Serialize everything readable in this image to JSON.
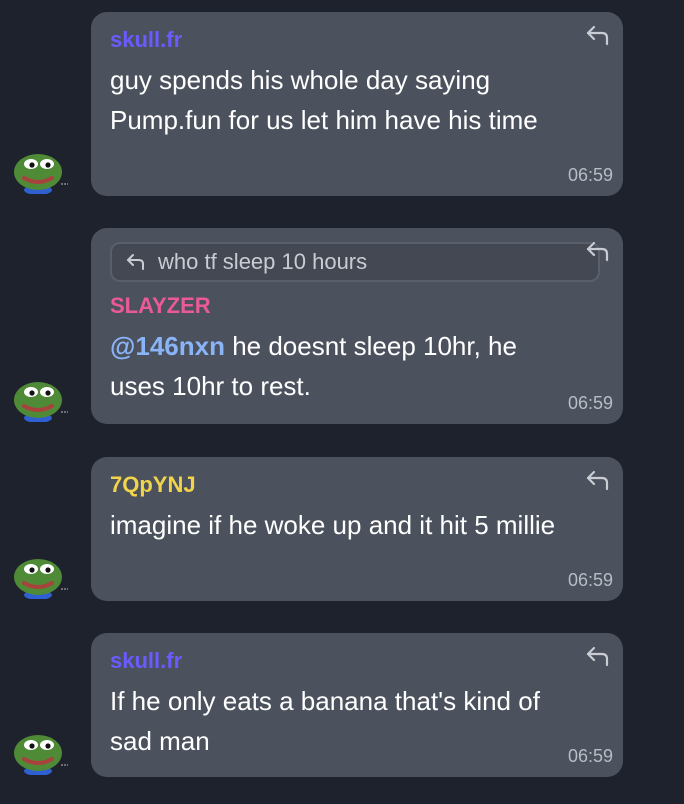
{
  "messages": [
    {
      "sender": "skull.fr",
      "sender_color": "#6a5bff",
      "text": "guy spends his whole day saying Pump.fun for us let him have his time",
      "time": "06:59"
    },
    {
      "quote": "who tf sleep 10 hours",
      "sender": "SLAYZER",
      "sender_color": "#ea5a96",
      "mention": "@146nxn",
      "text": " he doesnt sleep 10hr, he uses 10hr to rest.",
      "time": "06:59"
    },
    {
      "sender": "7QpYNJ",
      "sender_color": "#f0d44a",
      "text": "imagine if he woke up and it hit 5 millie",
      "time": "06:59"
    },
    {
      "sender": "skull.fr",
      "sender_color": "#6a5bff",
      "text": "If he only eats a banana that's kind of sad man",
      "time": "06:59"
    }
  ],
  "icons": {
    "reply": "reply-arrow-icon",
    "avatar": "pepe-frog-avatar"
  },
  "colors": {
    "background": "#1e222c",
    "bubble": "#4b515d",
    "mention": "#8ab4f8"
  }
}
